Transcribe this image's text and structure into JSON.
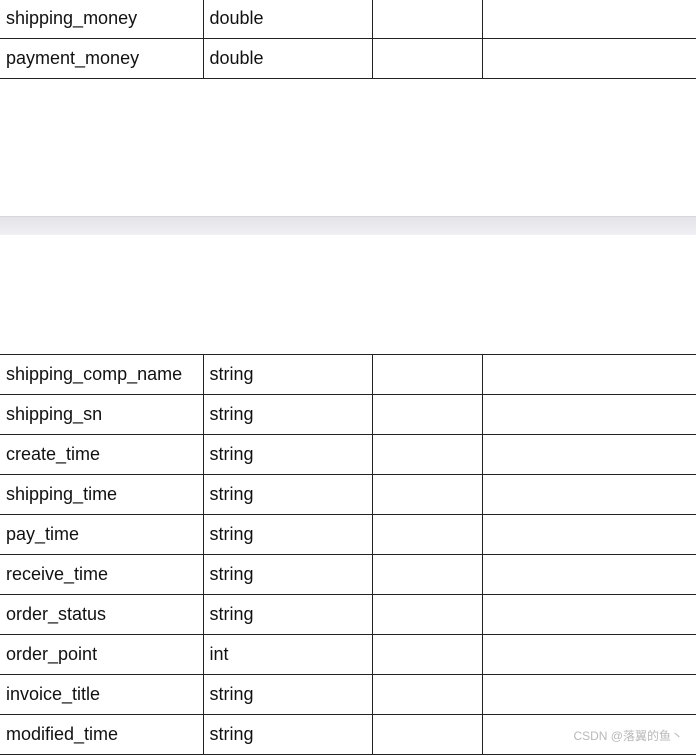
{
  "table_top": {
    "rows": [
      {
        "field": "shipping_money",
        "type": "double",
        "col3": "",
        "col4": ""
      },
      {
        "field": "payment_money",
        "type": "double",
        "col3": "",
        "col4": ""
      }
    ]
  },
  "table_bottom": {
    "rows": [
      {
        "field": "shipping_comp_name",
        "type": "string",
        "col3": "",
        "col4": ""
      },
      {
        "field": "shipping_sn",
        "type": "string",
        "col3": "",
        "col4": ""
      },
      {
        "field": "create_time",
        "type": "string",
        "col3": "",
        "col4": ""
      },
      {
        "field": "shipping_time",
        "type": "string",
        "col3": "",
        "col4": ""
      },
      {
        "field": "pay_time",
        "type": "string",
        "col3": "",
        "col4": ""
      },
      {
        "field": "receive_time",
        "type": "string",
        "col3": "",
        "col4": ""
      },
      {
        "field": "order_status",
        "type": "string",
        "col3": "",
        "col4": ""
      },
      {
        "field": "order_point",
        "type": "int",
        "col3": "",
        "col4": ""
      },
      {
        "field": "invoice_title",
        "type": "string",
        "col3": "",
        "col4": ""
      },
      {
        "field": "modified_time",
        "type": "string",
        "col3": "",
        "col4": ""
      }
    ]
  },
  "watermark": "CSDN @落翼的鱼丶"
}
